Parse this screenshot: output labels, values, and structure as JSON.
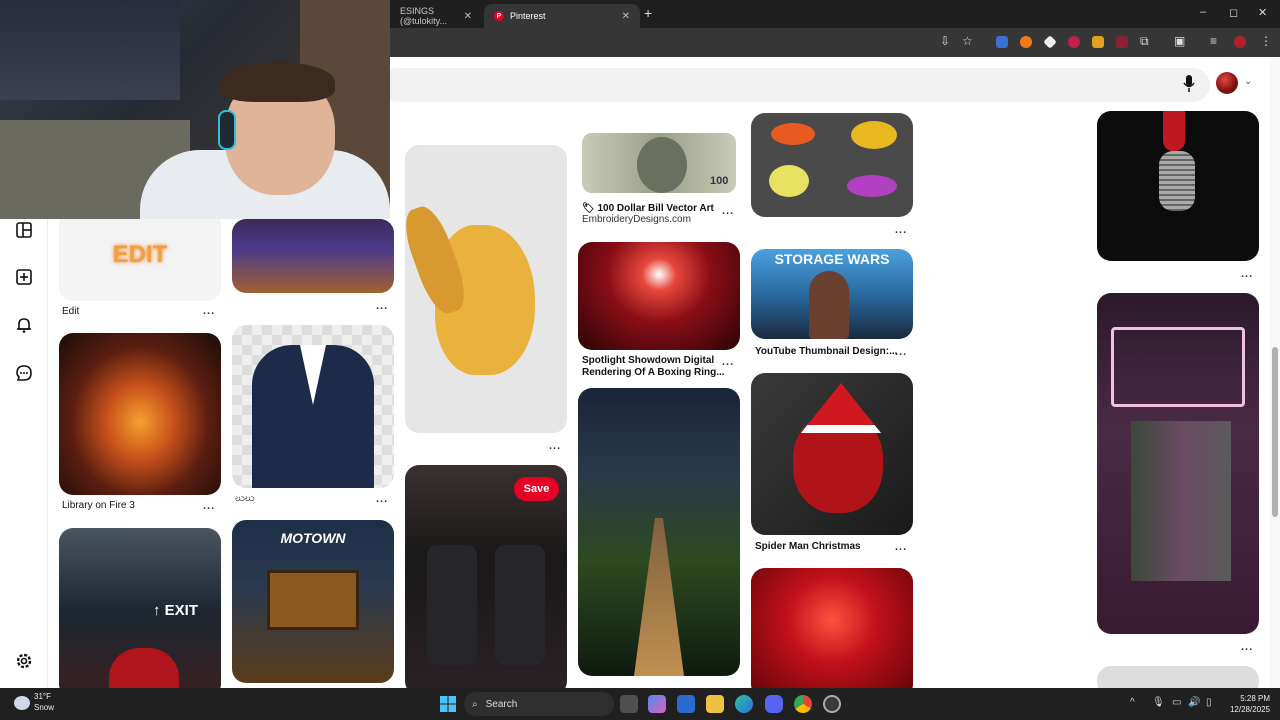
{
  "browser": {
    "tabs": [
      {
        "label": "ESINGS (@tulokity...",
        "active": false
      },
      {
        "label": "Pinterest",
        "active": true
      }
    ],
    "tab_close_glyph": "✕",
    "new_tab_glyph": "+",
    "window_controls": [
      "–",
      "◻",
      "✕"
    ]
  },
  "header": {
    "icons": [
      "microphone-icon",
      "avatar",
      "chevron-down-icon"
    ]
  },
  "left_rail": {
    "icons": [
      "boards-icon",
      "create-icon",
      "notifications-icon",
      "messages-icon",
      "settings-icon"
    ]
  },
  "pins": {
    "edit": {
      "tile_text": "EDIT",
      "caption": "Edit"
    },
    "library": {
      "caption": "Library on Fire 3"
    },
    "suit": {
      "caption": "ဃဃ"
    },
    "motown": {
      "tile_text": "MOTOWN"
    },
    "dollar": {
      "caption_line1": "🏷 100 Dollar Bill Vector Art",
      "caption_line2": "EmbroideryDesigns.com",
      "bill_text": "100"
    },
    "boxing": {
      "caption_line1": "Spotlight Showdown Digital",
      "caption_line2": "Rendering Of A Boxing Ring..."
    },
    "storage": {
      "tile_text": "STORAGE WARS",
      "caption": "YouTube Thumbnail Design:..."
    },
    "spiderman": {
      "caption": "Spider Man Christmas"
    },
    "car": {
      "save_label": "Save"
    },
    "exit": {
      "tile_text": "↑ EXIT"
    },
    "more_glyph": "..."
  },
  "taskbar": {
    "weather_temp": "31°F",
    "weather_desc": "Snow",
    "search_label": "Search",
    "time": "5:28 PM",
    "date": "12/28/2025"
  },
  "colors": {
    "pinterest_red": "#e60023",
    "taskbar": "#202020",
    "chrome_dark": "#1f1f1f"
  }
}
